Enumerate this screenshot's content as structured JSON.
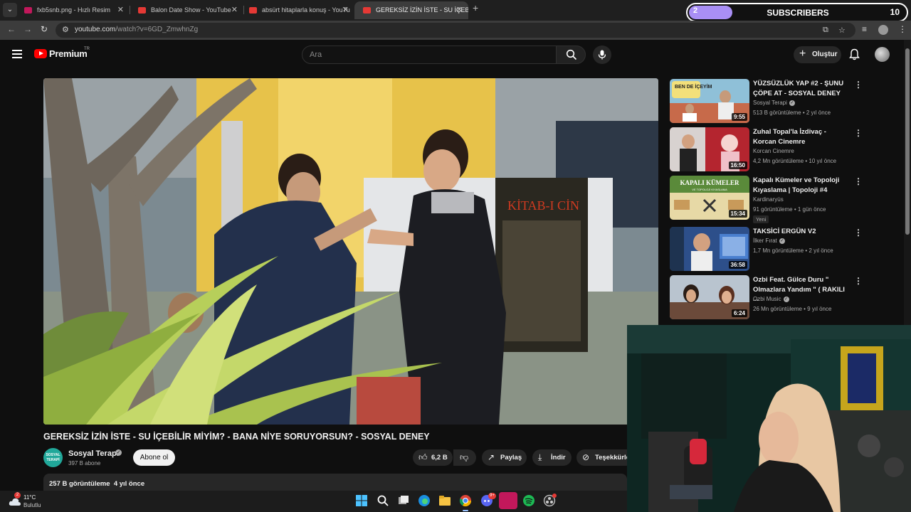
{
  "browser": {
    "tabs": [
      {
        "label": "fxb5snb.png - Hızlı Resim",
        "active": false
      },
      {
        "label": "Balon Date Show - YouTube",
        "active": false
      },
      {
        "label": "absürt hitaplarla konuş - YouTu",
        "active": false
      },
      {
        "label": "GEREKSİZ İZİN İSTE - SU İÇEBİLİ",
        "active": true
      }
    ],
    "new_tab": "+",
    "url_host": "youtube.com",
    "url_path": "/watch?v=6GD_ZmwhnZg"
  },
  "subscriber_widget": {
    "current": "2",
    "label": "SUBSCRIBERS",
    "goal": "10",
    "progress_fraction": 0.2
  },
  "youtube": {
    "brand": "Premium",
    "country_code": "TR",
    "search_placeholder": "Ara",
    "create_label": "Oluştur"
  },
  "video": {
    "title": "GEREKSİZ İZİN İSTE - SU İÇEBİLİR MİYİM? - BANA NİYE SORUYORSUN? - SOSYAL DENEY",
    "scene_poster_text": "KİTAB-I CİN",
    "channel": {
      "name": "Sosyal Terapi",
      "subs": "397 B abone",
      "logo_text": "SOSYAL TERAPİ"
    },
    "subscribe_label": "Abone ol",
    "likes": "6,2 B",
    "share_label": "Paylaş",
    "download_label": "İndir",
    "thanks_label": "Teşekkürle",
    "views": "257 B görüntüleme",
    "age": "4 yıl önce"
  },
  "recommendations": [
    {
      "title": "YÜZSÜZLÜK YAP #2 - ŞUNU ÇÖPE AT - SOSYAL DENEY",
      "channel": "Sosyal Terapi",
      "verified": true,
      "meta": "513 B görüntüleme • 2 yıl önce",
      "duration": "9:55",
      "thumb_text": "BEN DE İÇEYİM",
      "thumb_color": "#f3e07a"
    },
    {
      "title": "Zuhal Topal'la İzdivaç - Korcan Cinemre",
      "channel": "Korcan Cinemre",
      "verified": false,
      "meta": "4,2 Mn görüntüleme • 10 yıl önce",
      "duration": "16:50",
      "thumb_text": "",
      "thumb_color": "#b4252f"
    },
    {
      "title": "Kapalı Kümeler ve Topoloji Kıyaslama | Topoloji #4",
      "channel": "Kardinaryüs",
      "verified": false,
      "meta": "91 görüntüleme • 1 gün önce",
      "duration": "15:34",
      "badge": "Yeni",
      "thumb_text": "KAPALI KÜMELER",
      "thumb_subtext": "VE TOPOLOJİ KIYASLAMA",
      "thumb_color": "#5a8a3a"
    },
    {
      "title": "TAKSİCİ ERGÜN V2",
      "channel": "İlker Fırat",
      "verified": true,
      "meta": "1,7 Mn görüntüleme • 2 yıl önce",
      "duration": "36:58",
      "thumb_text": "",
      "thumb_color": "#2d4f8a"
    },
    {
      "title": "Ozbi Feat. Gülce Duru \" Olmazlara Yandım \" ( RAKILI ...",
      "channel": "Ozbi Music",
      "verified": true,
      "meta": "26 Mn görüntüleme • 9 yıl önce",
      "duration": "6:24",
      "thumb_text": "",
      "thumb_color": "#6b4a3a"
    }
  ],
  "taskbar": {
    "weather_temp": "11°C",
    "weather_cond": "Bulutlu",
    "weather_badge": "2",
    "discord_badge": "9+"
  },
  "colors": {
    "yt_red": "#ff0000",
    "subs_bar": "#a98ff5",
    "channel_logo": "#21a89a"
  }
}
